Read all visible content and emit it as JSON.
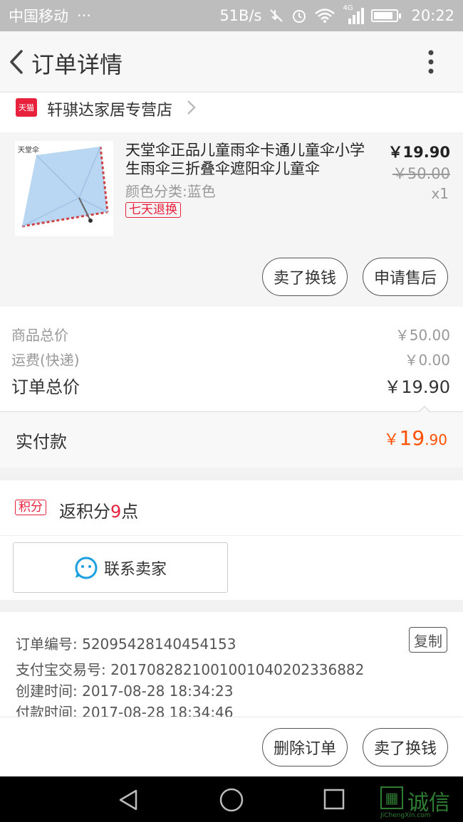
{
  "status_bar": {
    "carrier": "中国移动",
    "dots": "···",
    "speed": "51B/s",
    "network": "4G",
    "time": "20:22"
  },
  "app_bar": {
    "title": "订单详情"
  },
  "shop": {
    "badge": "天猫",
    "name": "轩骐达家居专营店"
  },
  "product": {
    "image_brand": "天堂伞",
    "name": "天堂伞正品儿童雨伞卡通儿童伞小学生雨伞三折叠伞遮阳伞儿童伞",
    "spec": "颜色分类:蓝色",
    "badge": "七天退换",
    "price": "￥19.90",
    "original_price": "￥50.00",
    "quantity": "x1",
    "buttons": [
      "卖了换钱",
      "申请售后"
    ]
  },
  "summary": {
    "rows": [
      {
        "label": "商品总价",
        "value": "￥50.00"
      },
      {
        "label": "运费(快递)",
        "value": "￥0.00"
      }
    ],
    "total_label": "订单总价",
    "total_value": "￥19.90",
    "paid_label": "实付款",
    "paid_currency": "￥",
    "paid_integer": "19",
    "paid_decimal": ".90"
  },
  "points": {
    "badge": "积分",
    "prefix": "返积分",
    "number": "9",
    "suffix": "点"
  },
  "contact": {
    "label": "联系卖家"
  },
  "order_info": {
    "lines": [
      "订单编号: 52095428140454153",
      "支付宝交易号: 2017082821001001040202336882",
      "创建时间: 2017-08-28 18:34:23",
      "付款时间: 2017-08-28 18:34:46"
    ],
    "copy_label": "复制"
  },
  "bottom_actions": [
    "删除订单",
    "卖了换钱"
  ],
  "watermark": {
    "text": "诚信",
    "subtext": "JiChengXin.com"
  },
  "colors": {
    "accent": "#ff5000",
    "tmall_red": "#e8213c"
  }
}
